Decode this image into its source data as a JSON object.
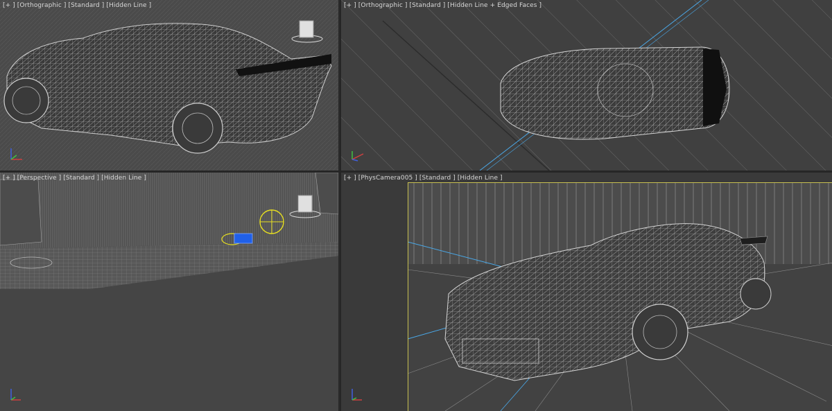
{
  "viewports": {
    "top_left": {
      "plus": "[+ ]",
      "view": "[Orthographic ]",
      "shading": "[Standard ]",
      "style": "[Hidden Line ]"
    },
    "top_right": {
      "plus": "[+ ]",
      "view": "[Orthographic ]",
      "shading": "[Standard ]",
      "style": "[Hidden Line + Edged Faces ]"
    },
    "bottom_left": {
      "plus": "[+ ]",
      "view": "[Perspective ]",
      "shading": "[Standard ]",
      "style": "[Hidden Line ]"
    },
    "bottom_right": {
      "plus": "[+ ]",
      "view": "[PhysCamera005 ]",
      "shading": "[Standard ]",
      "style": "[Hidden Line ]"
    }
  },
  "colors": {
    "viewport_bg": "#444444",
    "border": "#262626",
    "wire": "#c9c9c9",
    "camera_frame": "#c8c050",
    "light_blue": "#4aa8e8",
    "gizmo_x": "#d04040",
    "gizmo_y": "#40c040",
    "gizmo_z": "#4060e0"
  },
  "icons": [
    "axis-gizmo-icon",
    "light-icon",
    "camera-helper-icon"
  ]
}
